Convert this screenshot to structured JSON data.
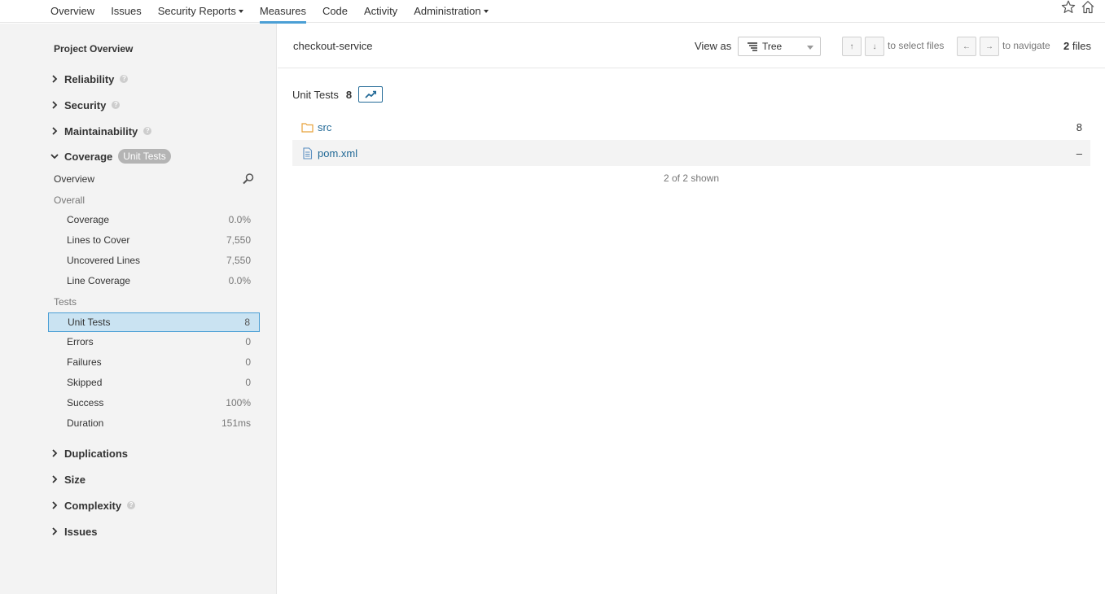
{
  "nav": {
    "tabs": [
      {
        "label": "Overview"
      },
      {
        "label": "Issues"
      },
      {
        "label": "Security Reports"
      },
      {
        "label": "Measures"
      },
      {
        "label": "Code"
      },
      {
        "label": "Activity"
      },
      {
        "label": "Administration"
      }
    ],
    "active_tab": "Measures",
    "icons": [
      "star-icon",
      "home-icon"
    ]
  },
  "sidebar": {
    "title": "Project Overview",
    "domains": {
      "reliability": "Reliability",
      "security": "Security",
      "maintainability": "Maintainability",
      "coverage": "Coverage",
      "coverage_badge": "Unit Tests",
      "duplications": "Duplications",
      "size": "Size",
      "complexity": "Complexity",
      "issues": "Issues"
    },
    "coverage": {
      "overview_label": "Overview",
      "overall_label": "Overall",
      "overall": [
        {
          "label": "Coverage",
          "value": "0.0%"
        },
        {
          "label": "Lines to Cover",
          "value": "7,550"
        },
        {
          "label": "Uncovered Lines",
          "value": "7,550"
        },
        {
          "label": "Line Coverage",
          "value": "0.0%"
        }
      ],
      "tests_label": "Tests",
      "tests": [
        {
          "label": "Unit Tests",
          "value": "8",
          "selected": true
        },
        {
          "label": "Errors",
          "value": "0"
        },
        {
          "label": "Failures",
          "value": "0"
        },
        {
          "label": "Skipped",
          "value": "0"
        },
        {
          "label": "Success",
          "value": "100%"
        },
        {
          "label": "Duration",
          "value": "151ms"
        }
      ]
    }
  },
  "main": {
    "breadcrumb": "checkout-service",
    "view_as_label": "View as",
    "view_as_value": "Tree",
    "select_keys": [
      "↑",
      "↓"
    ],
    "select_hint": "to select files",
    "nav_keys": [
      "←",
      "→"
    ],
    "nav_hint": "to navigate",
    "files_count": "2",
    "files_label": "files",
    "metric_title": "Unit Tests",
    "metric_value": "8",
    "rows": [
      {
        "name": "src",
        "type": "folder",
        "value": "8"
      },
      {
        "name": "pom.xml",
        "type": "file",
        "value": "–"
      }
    ],
    "shown_text": "2 of 2 shown"
  },
  "colors": {
    "accent": "#4b9fd5",
    "link": "#236a97",
    "selected_bg": "#cae3f2",
    "sidebar_bg": "#f3f3f3",
    "folder": "#e8a23b"
  }
}
